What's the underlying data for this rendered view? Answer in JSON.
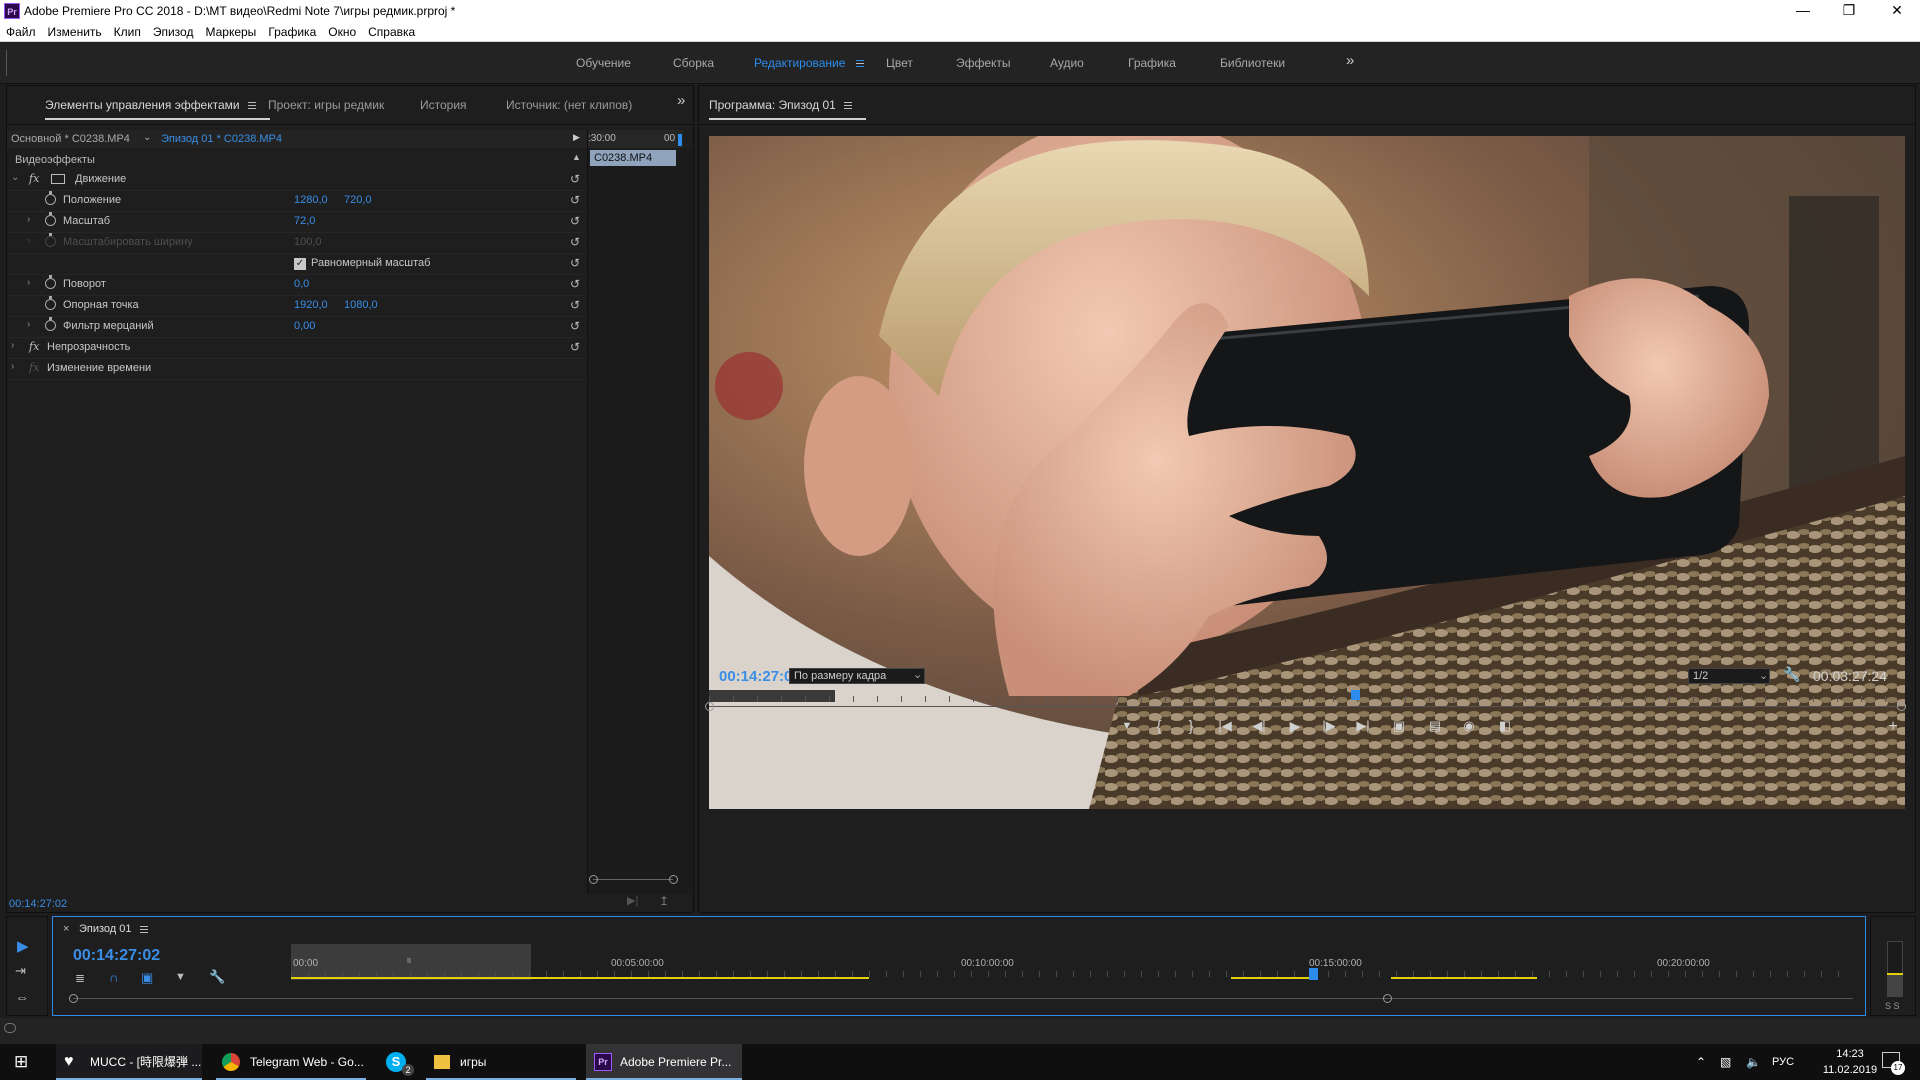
{
  "window": {
    "title": "Adobe Premiere Pro CC 2018 - D:\\MT видео\\Redmi Note 7\\игры редмик.prproj *",
    "app_badge": "Pr"
  },
  "menu": [
    "Файл",
    "Изменить",
    "Клип",
    "Эпизод",
    "Маркеры",
    "Графика",
    "Окно",
    "Справка"
  ],
  "workspaces": [
    "Обучение",
    "Сборка",
    "Редактирование",
    "Цвет",
    "Эффекты",
    "Аудио",
    "Графика",
    "Библиотеки"
  ],
  "active_workspace": "Редактирование",
  "left_panel": {
    "tabs": [
      "Элементы управления эффектами",
      "Проект: игры редмик",
      "История",
      "Источник: (нет клипов)"
    ],
    "master_clip": "Основной * C0238.MP4",
    "sequence_clip": "Эпизод 01 * C0238.MP4",
    "mini_time_start": ":30:00",
    "mini_time_end": "00",
    "clip_chip": "C0238.MP4",
    "section": "Видеоэффекты",
    "motion": "Движение",
    "props": {
      "position": {
        "label": "Положение",
        "x": "1280,0",
        "y": "720,0"
      },
      "scale": {
        "label": "Масштаб",
        "value": "72,0"
      },
      "scale_width": {
        "label": "Масштабировать ширину",
        "value": "100,0"
      },
      "uniform": {
        "label": "Равномерный масштаб"
      },
      "rotation": {
        "label": "Поворот",
        "value": "0,0"
      },
      "anchor": {
        "label": "Опорная точка",
        "x": "1920,0",
        "y": "1080,0"
      },
      "flicker": {
        "label": "Фильтр мерцаний",
        "value": "0,00"
      }
    },
    "opacity": "Непрозрачность",
    "time_remap": "Изменение времени",
    "timecode": "00:14:27:02"
  },
  "program": {
    "tab": "Программа: Эпизод 01",
    "timecode": "00:14:27:02",
    "fit": "По размеру кадра",
    "resolution": "1/2",
    "duration": "00:03:27:24",
    "playhead_fraction": 0.54
  },
  "timeline": {
    "tab": "Эпизод 01",
    "timecode": "00:14:27:02",
    "ruler": [
      "00:00",
      "00:05:00:00",
      "00:10:00:00",
      "00:15:00:00",
      "00:20:00:00"
    ],
    "playhead_fraction": 0.655,
    "meter_label": "S S"
  },
  "taskbar": {
    "items": [
      "MUCC - [時限爆弾 ...",
      "Telegram Web - Go...",
      "игры",
      "Adobe Premiere Pr..."
    ],
    "skype_badge": "2",
    "lang": "РУС",
    "time": "14:23",
    "date": "11.02.2019",
    "notif_count": "17"
  },
  "colors": {
    "accent": "#2d8ceb",
    "panel": "#1e1e1e",
    "yellow": "#e3d000"
  }
}
